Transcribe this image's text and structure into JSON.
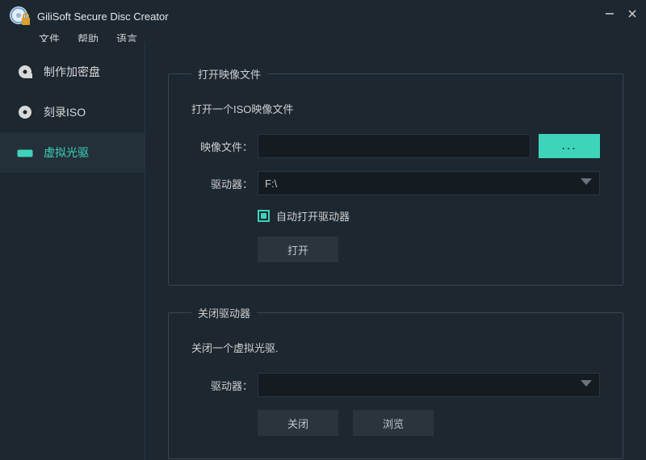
{
  "app": {
    "title": "GiliSoft Secure Disc Creator"
  },
  "menu": {
    "file": "文件",
    "help": "帮助",
    "language": "语言"
  },
  "sidebar": {
    "items": [
      {
        "label": "制作加密盘"
      },
      {
        "label": "刻录ISO"
      },
      {
        "label": "虚拟光驱"
      }
    ],
    "activeIndex": 2
  },
  "panel1": {
    "legend": "打开映像文件",
    "desc": "打开一个ISO映像文件",
    "imageFileLabel": "映像文件：",
    "imageFileValue": "",
    "browseLabel": "...",
    "driveLabel": "驱动器：",
    "driveValue": "F:\\",
    "autoOpenLabel": "自动打开驱动器",
    "autoOpenChecked": true,
    "openBtn": "打开"
  },
  "panel2": {
    "legend": "关闭驱动器",
    "desc": "关闭一个虚拟光驱.",
    "driveLabel": "驱动器：",
    "driveValue": "",
    "closeBtn": "关闭",
    "browseBtn": "浏览"
  }
}
